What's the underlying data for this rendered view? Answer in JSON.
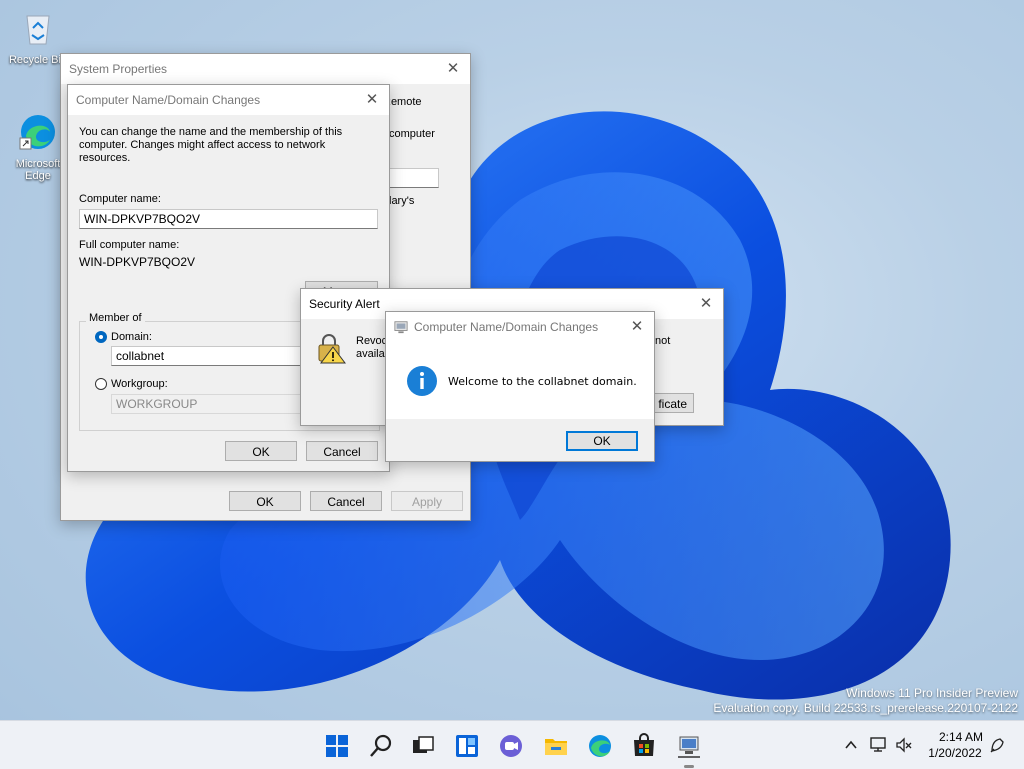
{
  "desktop": {
    "recycle_bin_label": "Recycle Bin",
    "edge_label": "Microsoft Edge"
  },
  "system_properties": {
    "title": "System Properties",
    "partial_tab": "Remote",
    "partial_text_1": "computer",
    "partial_text_2": "lary's",
    "ok": "OK",
    "cancel": "Cancel",
    "apply": "Apply"
  },
  "cn_dialog": {
    "title": "Computer Name/Domain Changes",
    "description": "You can change the name and the membership of this computer. Changes might affect access to network resources.",
    "computer_name_label": "Computer name:",
    "computer_name_value": "WIN-DPKVP7BQO2V",
    "full_name_label": "Full computer name:",
    "full_name_value": "WIN-DPKVP7BQO2V",
    "more_button": "More...",
    "member_of_label": "Member of",
    "domain_label": "Domain:",
    "domain_value": "collabnet",
    "workgroup_label": "Workgroup:",
    "workgroup_value": "WORKGROUP",
    "ok": "OK",
    "cancel": "Cancel"
  },
  "security_alert": {
    "title": "Security Alert",
    "partial_text_1": "Revoc",
    "partial_text_2": "availa",
    "partial_text_3": "not",
    "partial_button": "ficate"
  },
  "welcome_dialog": {
    "title": "Computer Name/Domain Changes",
    "message": "Welcome to the collabnet domain.",
    "ok": "OK"
  },
  "watermark": {
    "line1": "Windows 11 Pro Insider Preview",
    "line2": "Evaluation copy. Build 22533.rs_prerelease.220107-2122"
  },
  "taskbar": {
    "time": "2:14 AM",
    "date": "1/20/2022",
    "icons": [
      "start-icon",
      "search-icon",
      "task-view-icon",
      "widgets-icon",
      "chat-icon",
      "file-explorer-icon",
      "edge-icon",
      "store-icon",
      "network-app-icon"
    ]
  },
  "colors": {
    "accent": "#0078d7",
    "info": "#1a7fd6"
  }
}
